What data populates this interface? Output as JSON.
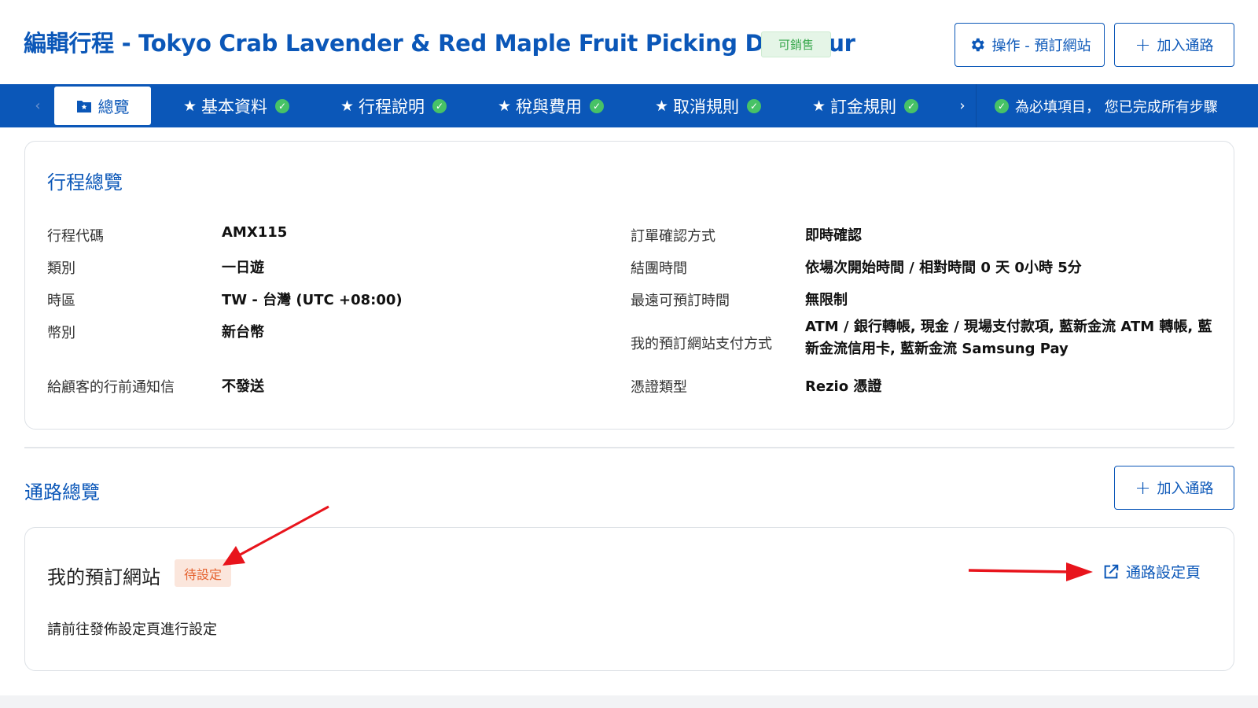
{
  "header": {
    "title": "編輯行程 - Tokyo Crab Lavender & Red Maple Fruit Picking Day Tour",
    "status_badge": "可銷售",
    "ops_button": "操作 - 預訂網站",
    "add_channel_button": "加入通路"
  },
  "tabs": {
    "active": "總覽",
    "items": [
      {
        "label": "基本資料"
      },
      {
        "label": "行程說明"
      },
      {
        "label": "稅與費用"
      },
      {
        "label": "取消規則"
      },
      {
        "label": "訂金規則"
      }
    ],
    "status": "為必填項目， 您已完成所有步驟"
  },
  "overview": {
    "title": "行程總覽",
    "left": [
      {
        "label": "行程代碼",
        "value": "AMX115"
      },
      {
        "label": "類別",
        "value": "一日遊"
      },
      {
        "label": "時區",
        "value": "TW - 台灣 (UTC +08:00)"
      },
      {
        "label": "幣別",
        "value": "新台幣"
      },
      {
        "label": "給顧客的行前通知信",
        "value": "不發送"
      }
    ],
    "right": [
      {
        "label": "訂單確認方式",
        "value": "即時確認"
      },
      {
        "label": "結團時間",
        "value": "依場次開始時間 / 相對時間 0 天 0小時 5分"
      },
      {
        "label": "最遠可預訂時間",
        "value": "無限制"
      },
      {
        "label": "我的預訂網站支付方式",
        "value": "ATM / 銀行轉帳, 現金 / 現場支付款項, 藍新金流 ATM 轉帳, 藍新金流信用卡, 藍新金流 Samsung Pay"
      },
      {
        "label": "憑證類型",
        "value": "Rezio 憑證"
      }
    ]
  },
  "channels": {
    "title": "通路總覽",
    "add_button": "加入通路",
    "card": {
      "name": "我的預訂網站",
      "badge": "待設定",
      "hint": "請前往發佈設定頁進行設定",
      "link": "通路設定頁"
    }
  },
  "colors": {
    "brand": "#0b57b8",
    "success": "#47c266",
    "pending": "#e5612e",
    "annotation_arrow": "#e8141c"
  }
}
